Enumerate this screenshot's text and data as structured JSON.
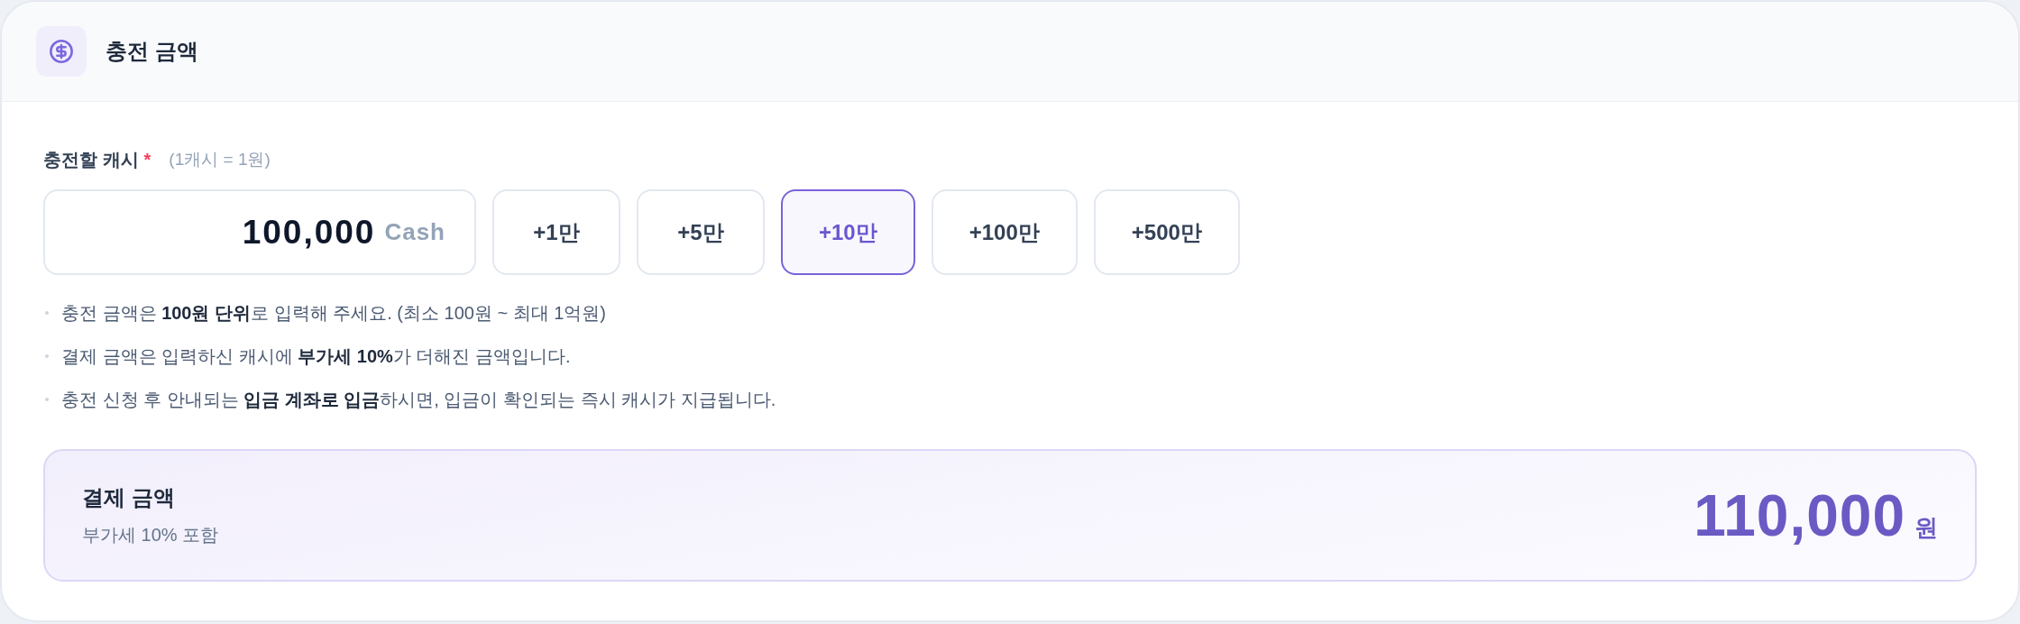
{
  "header": {
    "title": "충전 금액"
  },
  "cash_field": {
    "label": "충전할 캐시",
    "required_mark": "*",
    "hint": "(1캐시 = 1원)",
    "value": "100,000",
    "unit": "Cash"
  },
  "quick_amounts": [
    {
      "label": "+1만",
      "selected": false
    },
    {
      "label": "+5만",
      "selected": false
    },
    {
      "label": "+10만",
      "selected": true
    },
    {
      "label": "+100만",
      "selected": false
    },
    {
      "label": "+500만",
      "selected": false
    }
  ],
  "notes": [
    "충전 금액은 **100원 단위**로 입력해 주세요. (최소 100원 ~ 최대 1억원)",
    "결제 금액은 입력하신 캐시에 **부가세 10%**가 더해진 금액입니다.",
    "충전 신청 후 안내되는 **입금 계좌로 입금**하시면, 입금이 확인되는 즉시 캐시가 지급됩니다."
  ],
  "payment_summary": {
    "title": "결제 금액",
    "subtitle": "부가세 10% 포함",
    "amount": "110,000",
    "currency": "원"
  }
}
